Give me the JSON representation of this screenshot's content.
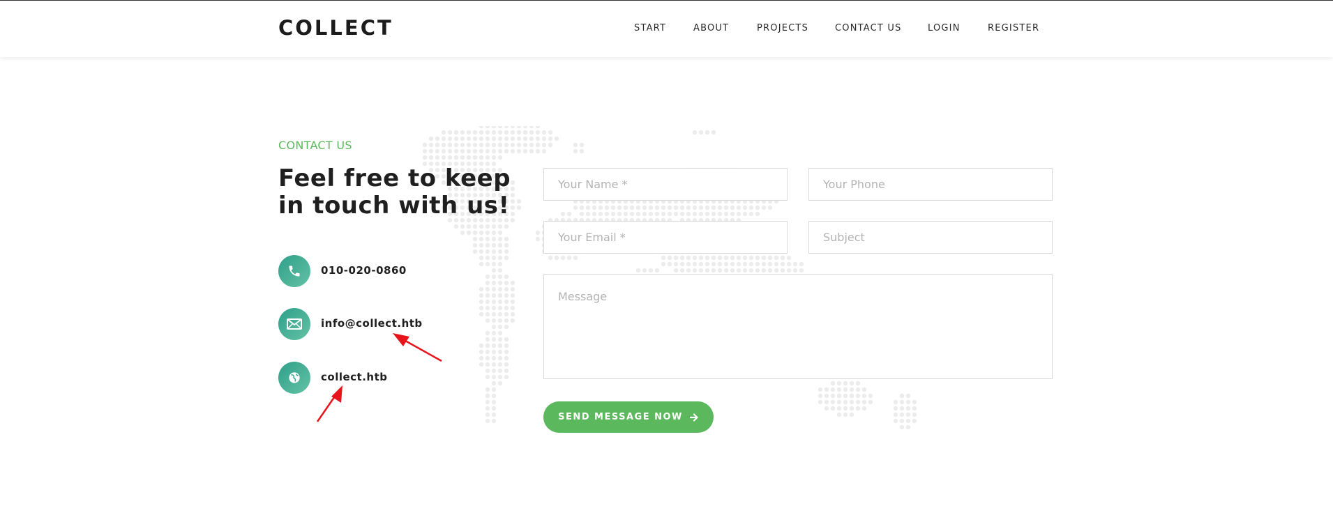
{
  "header": {
    "logo": "COLLECT",
    "nav": [
      {
        "label": "START"
      },
      {
        "label": "ABOUT"
      },
      {
        "label": "PROJECTS"
      },
      {
        "label": "CONTACT US"
      },
      {
        "label": "LOGIN"
      },
      {
        "label": "REGISTER"
      }
    ]
  },
  "contact": {
    "eyebrow": "CONTACT US",
    "heading": "Feel free to keep in touch with us!",
    "items": [
      {
        "icon": "phone-icon",
        "text": "010-020-0860"
      },
      {
        "icon": "envelope-icon",
        "text": "info@collect.htb"
      },
      {
        "icon": "globe-icon",
        "text": "collect.htb"
      }
    ]
  },
  "form": {
    "name_placeholder": "Your Name *",
    "phone_placeholder": "Your Phone",
    "email_placeholder": "Your Email *",
    "subject_placeholder": "Subject",
    "message_placeholder": "Message",
    "submit_label": "SEND MESSAGE NOW",
    "submit_icon": "arrow-right-icon"
  },
  "colors": {
    "accent_green": "#5cb85c",
    "icon_gradient_start": "#2f9f8a",
    "icon_gradient_end": "#63c2a4",
    "annotation_arrow": "#e8141c"
  }
}
